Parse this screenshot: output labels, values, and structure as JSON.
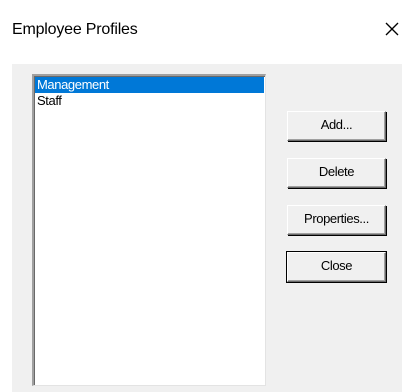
{
  "window": {
    "title": "Employee Profiles",
    "close_glyph": "close-icon"
  },
  "profiles_list": {
    "items": [
      {
        "label": "Management",
        "selected": true
      },
      {
        "label": "Staff",
        "selected": false
      }
    ]
  },
  "buttons": {
    "add_label": "Add...",
    "delete_label": "Delete",
    "properties_label": "Properties...",
    "close_label": "Close"
  },
  "colors": {
    "selection": "#0078d7",
    "dialog_face": "#f0f0f0",
    "title_bar": "#ffffff"
  }
}
